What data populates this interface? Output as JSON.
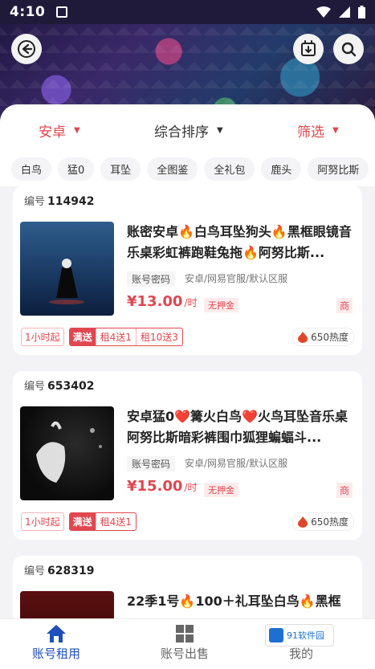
{
  "status_bar": {
    "time": "4:10"
  },
  "filters": {
    "os": "安卓",
    "sort": "综合排序",
    "screen": "筛选"
  },
  "tags": [
    "白鸟",
    "猛0",
    "耳坠",
    "全图鉴",
    "全礼包",
    "鹿头",
    "阿努比斯"
  ],
  "listings": [
    {
      "id_label": "编号",
      "id": "114942",
      "title": "账密安卓🔥白鸟耳坠狗头🔥黑框眼镜音乐桌彩虹裤跑鞋兔拖🔥阿努比斯...",
      "login_mode": "账号密码",
      "server": "安卓/网易官服/默认区服",
      "price": "¥13.00",
      "price_unit": "/时",
      "deposit": "无押金",
      "merchant": "商",
      "min_rent": "1小时起",
      "promo_label": "满送",
      "promos": [
        "租4送1",
        "租10送3"
      ],
      "heat": "650热度"
    },
    {
      "id_label": "编号",
      "id": "653402",
      "title": "安卓猛0❤️篝火白鸟❤️火鸟耳坠音乐桌阿努比斯暗彩裤围巾狐狸蝙蝠斗...",
      "login_mode": "账号密码",
      "server": "安卓/网易官服/默认区服",
      "price": "¥15.00",
      "price_unit": "/时",
      "deposit": "无押金",
      "merchant": "商",
      "min_rent": "1小时起",
      "promo_label": "满送",
      "promos": [
        "租4送1"
      ],
      "heat": "650热度"
    },
    {
      "id_label": "编号",
      "id": "628319",
      "title": "22季1号🔥100＋礼耳坠白鸟🔥黑框"
    }
  ],
  "nav": {
    "rent": "账号租用",
    "sell": "账号出售",
    "mine": "我的"
  },
  "watermark": "91软件园",
  "colors": {
    "accent": "#e0474f",
    "nav_active": "#1f4fb8"
  }
}
